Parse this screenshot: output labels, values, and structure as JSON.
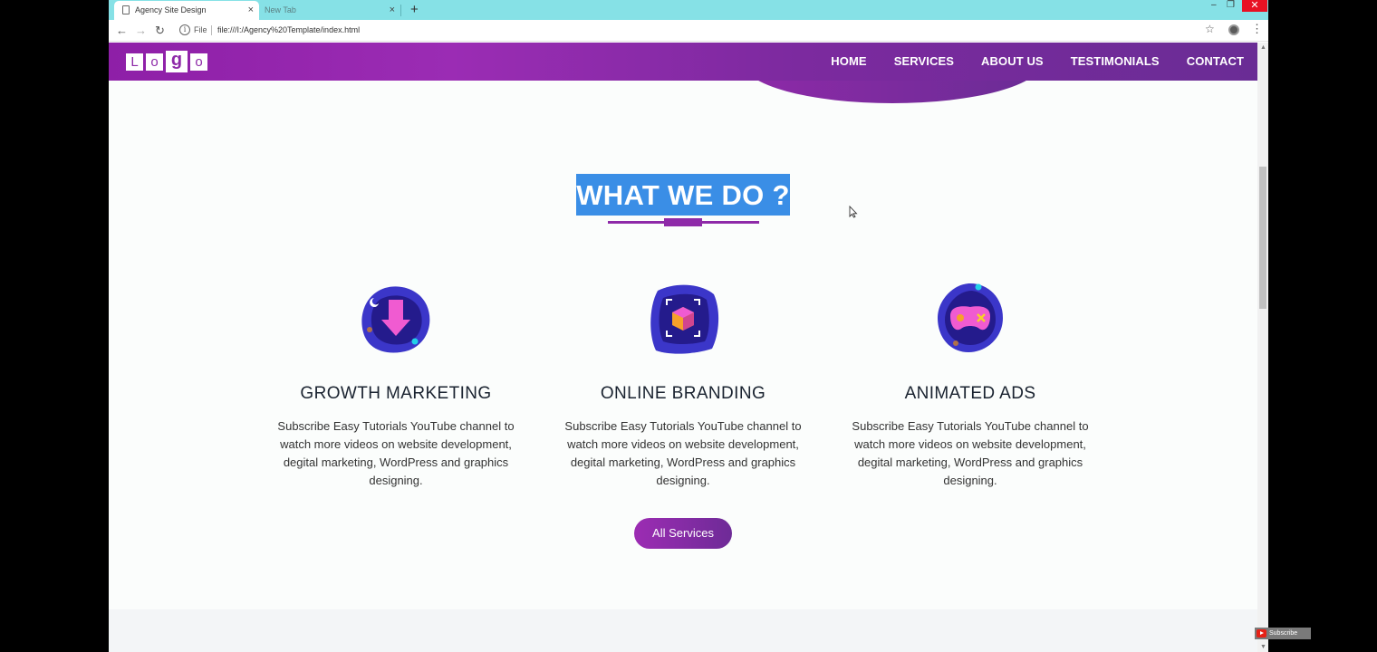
{
  "browser": {
    "tabs": [
      {
        "title": "Agency Site Design",
        "active": true
      },
      {
        "title": "New Tab",
        "active": false
      }
    ],
    "new_tab_glyph": "+",
    "close_glyph": "×",
    "url_scheme_label": "File",
    "url": "file:///I:/Agency%20Template/index.html",
    "icons": [
      "back-arrow-icon",
      "forward-arrow-icon",
      "reload-icon",
      "info-icon",
      "star-icon",
      "profile-icon",
      "menu-dots-icon"
    ]
  },
  "navbar": {
    "logo_letters": [
      "L",
      "o",
      "g",
      "o"
    ],
    "menu": [
      "HOME",
      "SERVICES",
      "ABOUT US",
      "TESTIMONIALS",
      "CONTACT"
    ]
  },
  "section": {
    "title": "WHAT WE DO ?",
    "services": [
      {
        "icon": "download-arrow-icon",
        "title": "GROWTH MARKETING",
        "text": "Subscribe Easy Tutorials YouTube channel to watch more videos on website development, degital marketing, WordPress and graphics designing."
      },
      {
        "icon": "3d-box-icon",
        "title": "ONLINE BRANDING",
        "text": "Subscribe Easy Tutorials YouTube channel to watch more videos on website development, degital marketing, WordPress and graphics designing."
      },
      {
        "icon": "gamepad-icon",
        "title": "ANIMATED ADS",
        "text": "Subscribe Easy Tutorials YouTube channel to watch more videos on website development, degital marketing, WordPress and graphics designing."
      }
    ],
    "button_label": "All Services"
  },
  "overlay": {
    "subscribe_label": "Subscribe"
  },
  "colors": {
    "brand_purple": "#8e2aa8",
    "selection_blue": "#3a8ee6",
    "tab_strip": "#86e1e6"
  }
}
